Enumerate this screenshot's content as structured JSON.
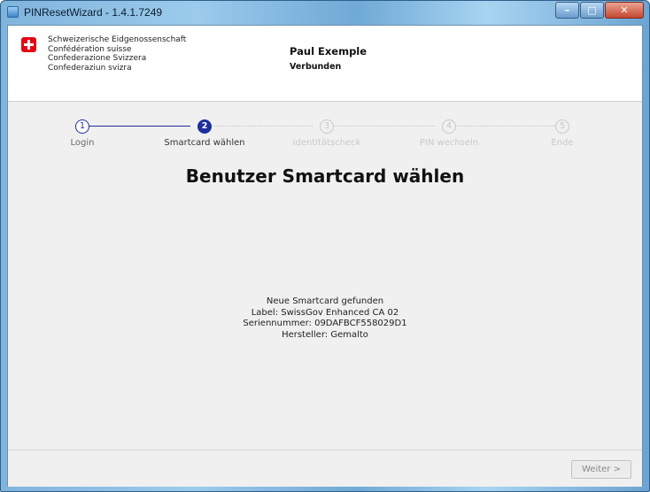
{
  "window": {
    "title": "PINResetWizard - 1.4.1.7249",
    "controls": {
      "minimize": "–",
      "maximize": "□",
      "close": "✕"
    }
  },
  "header": {
    "confederation_lines": [
      "Schweizerische Eidgenossenschaft",
      "Confédération suisse",
      "Confederazione Svizzera",
      "Confederaziun svizra"
    ],
    "user_name": "Paul Exemple",
    "user_status": "Verbunden",
    "logo_icon": "swiss-cross-icon",
    "logo_color": "#e30613"
  },
  "steps": [
    {
      "number": "1",
      "label": "Login",
      "state": "done"
    },
    {
      "number": "2",
      "label": "Smartcard wählen",
      "state": "active"
    },
    {
      "number": "3",
      "label": "Identitätscheck",
      "state": "pending"
    },
    {
      "number": "4",
      "label": "PIN wechseln",
      "state": "pending"
    },
    {
      "number": "5",
      "label": "Ende",
      "state": "pending"
    }
  ],
  "main": {
    "title": "Benutzer Smartcard wählen",
    "info_lines": [
      "Neue Smartcard gefunden",
      "Label: SwissGov Enhanced CA 02",
      "Seriennummer: 09DAFBCF558029D1",
      "Hersteller: Gemalto"
    ]
  },
  "footer": {
    "next_label": "Weiter >"
  },
  "colors": {
    "accent": "#1d2f9a",
    "pending": "#c9c9c9"
  }
}
